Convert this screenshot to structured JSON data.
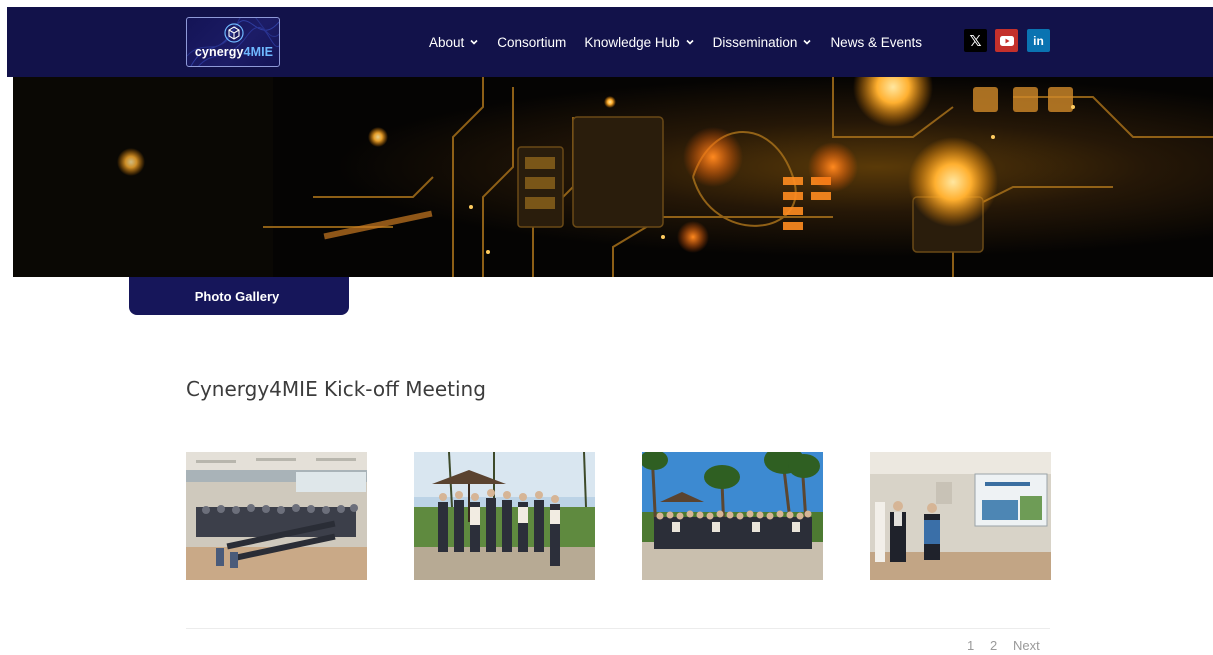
{
  "header": {
    "logo": {
      "text_main": "cynergy",
      "text_highlight": "4MIE",
      "icon": "cube-icon"
    },
    "nav": [
      {
        "label": "About",
        "has_dropdown": true
      },
      {
        "label": "Consortium",
        "has_dropdown": false
      },
      {
        "label": "Knowledge Hub",
        "has_dropdown": true
      },
      {
        "label": "Dissemination",
        "has_dropdown": true
      },
      {
        "label": "News & Events",
        "has_dropdown": false
      }
    ],
    "social": [
      {
        "name": "x-icon",
        "glyph": "𝕏"
      },
      {
        "name": "youtube-icon",
        "glyph": ""
      },
      {
        "name": "linkedin-icon",
        "glyph": "in"
      }
    ]
  },
  "tab": {
    "label": "Photo Gallery"
  },
  "gallery": {
    "title": "Cynergy4MIE Kick-off Meeting",
    "photos": [
      {
        "name": "photo-conference-room"
      },
      {
        "name": "photo-group-umbrella"
      },
      {
        "name": "photo-group-palms"
      },
      {
        "name": "photo-presentation"
      }
    ]
  },
  "pagination": {
    "pages": [
      "1",
      "2"
    ],
    "next": "Next"
  },
  "colors": {
    "nav_bg": "#12124a",
    "tab_bg": "#16165a",
    "youtube": "#c4302b",
    "linkedin": "#0a73b1"
  }
}
